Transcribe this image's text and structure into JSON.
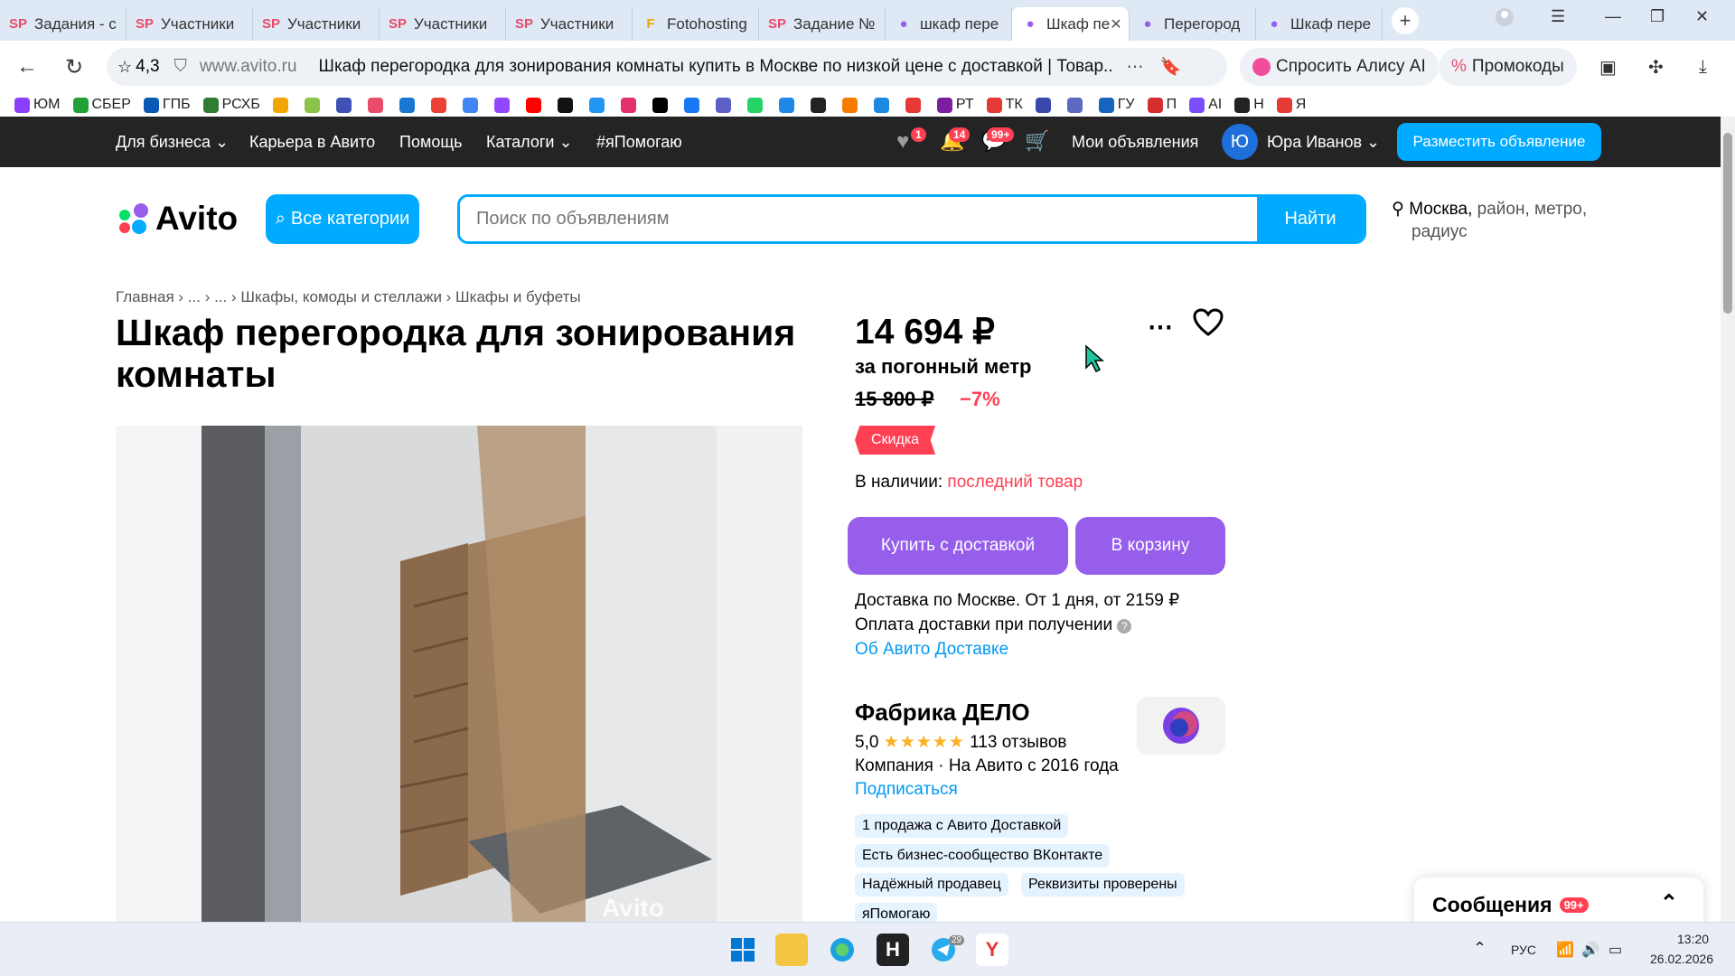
{
  "browser": {
    "tabs": [
      {
        "label": "Задания - с",
        "icon": "SP",
        "color": "#e94b6a"
      },
      {
        "label": "Участники",
        "icon": "SP",
        "color": "#e94b6a"
      },
      {
        "label": "Участники",
        "icon": "SP",
        "color": "#e94b6a"
      },
      {
        "label": "Участники",
        "icon": "SP",
        "color": "#e94b6a"
      },
      {
        "label": "Участники",
        "icon": "SP",
        "color": "#e94b6a"
      },
      {
        "label": "Fotohosting",
        "icon": "F",
        "color": "#f0a500"
      },
      {
        "label": "Задание №",
        "icon": "SP",
        "color": "#e94b6a"
      },
      {
        "label": "шкаф пере",
        "icon": "●",
        "color": "#965eeb"
      },
      {
        "label": "Шкаф пе",
        "icon": "●",
        "color": "#965eeb",
        "active": true
      },
      {
        "label": "Перегород",
        "icon": "●",
        "color": "#965eeb"
      },
      {
        "label": "Шкаф пере",
        "icon": "●",
        "color": "#965eeb"
      }
    ],
    "rating": "4,3",
    "domain": "www.avito.ru",
    "page_title": "Шкаф перегородка для зонирования комнаты купить в Москве по низкой цене с доставкой | Товар...",
    "alice": "Спросить Алису AI",
    "promo": "Промокоды",
    "bookmarks": [
      {
        "label": "ЮМ",
        "color": "#8b3ffd"
      },
      {
        "label": "СБЕР",
        "color": "#21a038"
      },
      {
        "label": "ГПБ",
        "color": "#0a5ab5"
      },
      {
        "label": "РСХБ",
        "color": "#2e7d32"
      },
      {
        "label": "",
        "color": "#f0a500"
      },
      {
        "label": "",
        "color": "#8bc34a"
      },
      {
        "label": "",
        "color": "#3f51b5"
      },
      {
        "label": "",
        "color": "#e94b6a"
      },
      {
        "label": "",
        "color": "#1976d2"
      },
      {
        "label": "",
        "color": "#ea4335"
      },
      {
        "label": "",
        "color": "#4285f4"
      },
      {
        "label": "",
        "color": "#9146ff"
      },
      {
        "label": "",
        "color": "#ff0000"
      },
      {
        "label": "",
        "color": "#111"
      },
      {
        "label": "",
        "color": "#2196f3"
      },
      {
        "label": "",
        "color": "#e1306c"
      },
      {
        "label": "",
        "color": "#000"
      },
      {
        "label": "",
        "color": "#1877f2"
      },
      {
        "label": "",
        "color": "#5b5fc7"
      },
      {
        "label": "",
        "color": "#25d366"
      },
      {
        "label": "",
        "color": "#1e88e5"
      },
      {
        "label": "",
        "color": "#222"
      },
      {
        "label": "",
        "color": "#f57c00"
      },
      {
        "label": "",
        "color": "#1e88e5"
      },
      {
        "label": "",
        "color": "#e53935"
      },
      {
        "label": "РТ",
        "color": "#7b1fa2"
      },
      {
        "label": "ТК",
        "color": "#e53935"
      },
      {
        "label": "",
        "color": "#3949ab"
      },
      {
        "label": "",
        "color": "#5c6bc0"
      },
      {
        "label": "ГУ",
        "color": "#1565c0"
      },
      {
        "label": "П",
        "color": "#d32f2f"
      },
      {
        "label": "AI",
        "color": "#7c4dff"
      },
      {
        "label": "Н",
        "color": "#222"
      },
      {
        "label": "Я",
        "color": "#e53935"
      }
    ]
  },
  "topbar": {
    "business": "Для бизнеса",
    "career": "Карьера в Авито",
    "help": "Помощь",
    "catalogs": "Каталоги",
    "help_tag": "#яПомогаю",
    "fav_count": "1",
    "notif_count": "14",
    "msg_count": "99+",
    "my_ads": "Мои объявления",
    "avatar_letter": "Ю",
    "user": "Юра Иванов",
    "post_ad": "Разместить объявление"
  },
  "header": {
    "logo": "Avito",
    "categories": "Все категории",
    "search_placeholder": "Поиск по объявлениям",
    "find": "Найти",
    "city": "Москва,",
    "loc_rest": " район, метро,",
    "loc_line2": "радиус"
  },
  "breadcrumbs": "Главная › ... › ... › Шкафы, комоды и стеллажи › Шкафы и буфеты",
  "item": {
    "title": "Шкаф перегородка для зонирования комнаты",
    "price": "14 694 ₽",
    "unit": "за погонный метр",
    "old_price": "15 800 ₽",
    "discount": "−7%",
    "sale_tag": "Скидка",
    "avail_label": "В наличии:",
    "avail_value": "последний товар",
    "buy": "Купить с доставкой",
    "cart": "В корзину",
    "delivery": "Доставка по Москве. От 1 дня, от 2159 ₽",
    "payment": "Оплата доставки при получении",
    "about_delivery": "Об Авито Доставке",
    "watermark": "Avito"
  },
  "seller": {
    "name": "Фабрика ДЕЛО",
    "rating": "5,0",
    "stars": "★★★★★",
    "reviews": "113 отзывов",
    "info": "Компания · На Авито с 2016 года",
    "subscribe": "Подписаться",
    "chips": [
      "1 продажа с Авито Доставкой",
      "Есть бизнес-сообщество ВКонтакте",
      "Надёжный продавец",
      "Реквизиты проверены",
      "яПомогаю"
    ]
  },
  "messages": {
    "label": "Сообщения",
    "count": "99+"
  },
  "taskbar": {
    "lang": "РУС",
    "time": "13:20",
    "date": "26.02.2026",
    "telegram_count": "29"
  }
}
